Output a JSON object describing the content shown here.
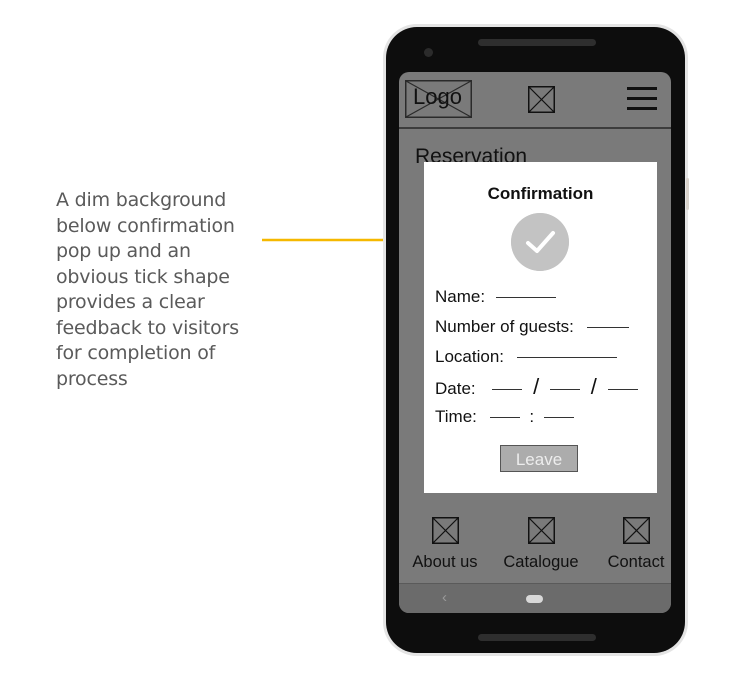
{
  "annotation": {
    "lines": [
      "A dim background",
      "below confirmation",
      "pop up and an",
      "obvious tick shape",
      "provides a clear",
      "feedback to visitors",
      "for completion of",
      "process"
    ],
    "arrow_color": "#f5b800"
  },
  "header": {
    "logo_label": "Logo"
  },
  "page": {
    "title": "Reservation"
  },
  "modal": {
    "title": "Confirmation",
    "fields": {
      "name": "Name:",
      "guests": "Number of guests:",
      "location": "Location:",
      "date": "Date:",
      "date_sep": "/",
      "time": "Time:",
      "time_sep": ":"
    },
    "leave_label": "Leave"
  },
  "bottom_nav": {
    "items": [
      {
        "label": "About us",
        "icon": "image-placeholder-icon"
      },
      {
        "label": "Catalogue",
        "icon": "image-placeholder-icon"
      },
      {
        "label": "Contact",
        "icon": "image-placeholder-icon"
      }
    ]
  },
  "system_nav": {
    "back_glyph": "‹"
  },
  "colors": {
    "dim_background": "#7a7a7a",
    "modal_background": "#ffffff",
    "check_circle": "#c3c3c3",
    "leave_button": "#acacac"
  }
}
